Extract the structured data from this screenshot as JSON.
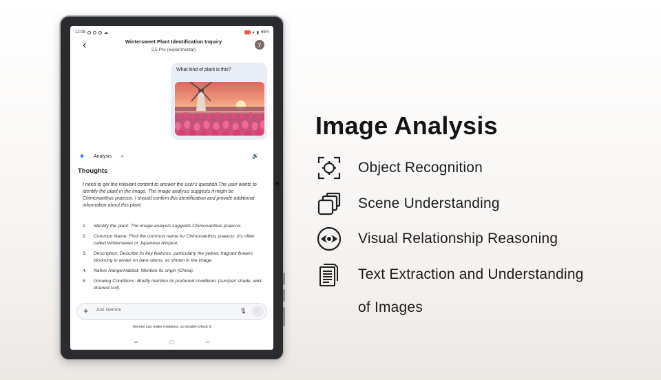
{
  "tablet": {
    "status_bar": {
      "time": "12:08",
      "battery": "66%"
    },
    "conversation": {
      "title": "Wintersweet Plant Identification Inquiry",
      "model": "2.5 Pro (experimental)",
      "avatar_letter": "y"
    },
    "user_message": {
      "text": "What kind of plant is this?",
      "image_icon": "windmill-tulip-field-photo"
    },
    "response": {
      "mode_label": "Analysis",
      "section_title": "Thoughts",
      "paragraph": "I need to get the relevant content to answer the user's question.The user wants to identify the plant in the image. The image analysis suggests it might be Chimonanthus praecox. I should confirm this identification and provide additional information about this plant.",
      "steps": [
        {
          "num": "1.",
          "text": "Identify the plant: The image analysis suggests Chimonanthus praecox."
        },
        {
          "num": "2.",
          "text": "Common Name: Find the common name for Chimonanthus praecox. It's often called Wintersweet or Japanese Allspice."
        },
        {
          "num": "3.",
          "text": "Description: Describe its key features, particularly the yellow, fragrant flowers blooming in winter on bare stems, as shown in the image."
        },
        {
          "num": "4.",
          "text": "Native Range/Habitat: Mention its origin (China)."
        },
        {
          "num": "5.",
          "text": "Growing Conditions: Briefly mention its preferred conditions (sun/part shade, well-drained soil)."
        }
      ]
    },
    "input": {
      "placeholder": "Ask Gemini"
    },
    "disclaimer": "Gemini can make mistakes, so double-check it"
  },
  "panel": {
    "title": "Image Analysis",
    "features": [
      {
        "label": "Object Recognition",
        "icon": "focus-target-icon"
      },
      {
        "label": "Scene Understanding",
        "icon": "stacked-layers-icon"
      },
      {
        "label": "Visual Relationship Reasoning",
        "icon": "eye-icon"
      },
      {
        "label": "Text Extraction and Understanding",
        "label_line2": "of Images",
        "icon": "documents-icon"
      }
    ]
  },
  "colors": {
    "gemini_accent": "#3b7ff2",
    "bubble": "#e9eef6",
    "headline": "#141414"
  }
}
